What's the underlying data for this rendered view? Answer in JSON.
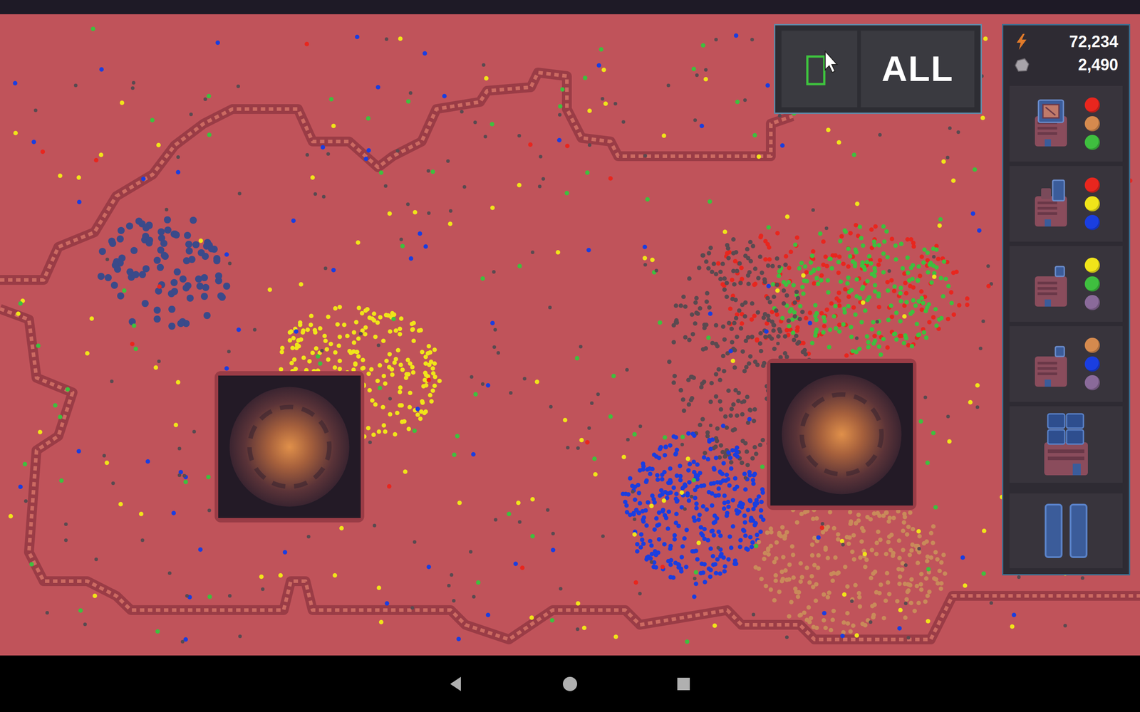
{
  "hud": {
    "resources": [
      {
        "kind": "energy",
        "value": "72,234"
      },
      {
        "kind": "stone",
        "value": "2,490"
      }
    ]
  },
  "selection": {
    "filter": "ALL"
  },
  "buildings": [
    {
      "kind": "generator",
      "resources": [
        {
          "color": "#e8261e"
        },
        {
          "color": "#d58a4e"
        },
        {
          "color": "#3fbf3f"
        }
      ]
    },
    {
      "kind": "refinery",
      "resources": [
        {
          "color": "#e8261e"
        },
        {
          "color": "#f0e41a"
        },
        {
          "color": "#1a3ee0"
        }
      ]
    },
    {
      "kind": "factory",
      "resources": [
        {
          "color": "#f0e41a"
        },
        {
          "color": "#3fbf3f"
        },
        {
          "color": "#8a6a9a"
        }
      ]
    },
    {
      "kind": "factory",
      "resources": [
        {
          "color": "#d58a4e"
        },
        {
          "color": "#1a3ee0"
        },
        {
          "color": "#8a6a9a"
        }
      ]
    },
    {
      "kind": "complex",
      "resources": []
    },
    {
      "kind": "battery",
      "resources": []
    }
  ],
  "map": {
    "unit_groups": [
      {
        "color": "#f0e41a",
        "count": 260
      },
      {
        "color": "#3a4a8a",
        "count": 90
      },
      {
        "color": "#e8261e",
        "count": 170
      },
      {
        "color": "#3fbf3f",
        "count": 200
      },
      {
        "color": "#5a4a50",
        "count": 260
      },
      {
        "color": "#1a3ee0",
        "count": 320
      },
      {
        "color": "#c98a5a",
        "count": 260
      },
      {
        "color": "#f0e41a",
        "count": 120
      },
      {
        "color": "#3fbf3f",
        "count": 100
      },
      {
        "color": "#1a3ee0",
        "count": 80
      },
      {
        "color": "#5a4a50",
        "count": 200
      },
      {
        "color": "#e8261e",
        "count": 20
      }
    ]
  }
}
